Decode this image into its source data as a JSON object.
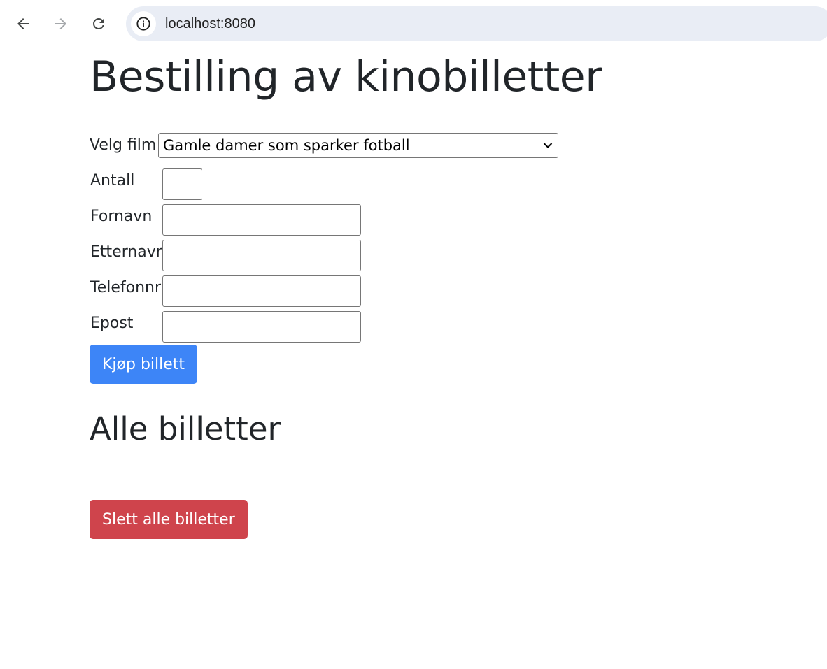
{
  "browser": {
    "url": "localhost:8080",
    "icons": [
      "back-arrow-icon",
      "forward-arrow-icon",
      "reload-icon",
      "info-icon"
    ]
  },
  "page": {
    "title": "Bestilling av kinobilletter",
    "form": {
      "film_label": "Velg film",
      "film_selected": "Gamle damer som sparker fotball",
      "antall_label": "Antall",
      "antall_value": "",
      "fornavn_label": "Fornavn",
      "fornavn_value": "",
      "etternavn_label": "Etternavn",
      "etternavn_value": "",
      "telefonnr_label": "Telefonnr",
      "telefonnr_value": "",
      "epost_label": "Epost",
      "epost_value": "",
      "submit_label": "Kjøp billett"
    },
    "tickets": {
      "heading": "Alle billetter",
      "items": [],
      "delete_all_label": "Slett alle billetter"
    }
  },
  "colors": {
    "primary_button": "#3d85f7",
    "danger_button": "#cf444c",
    "text": "#212529",
    "omnibox": "#e9edf5"
  }
}
